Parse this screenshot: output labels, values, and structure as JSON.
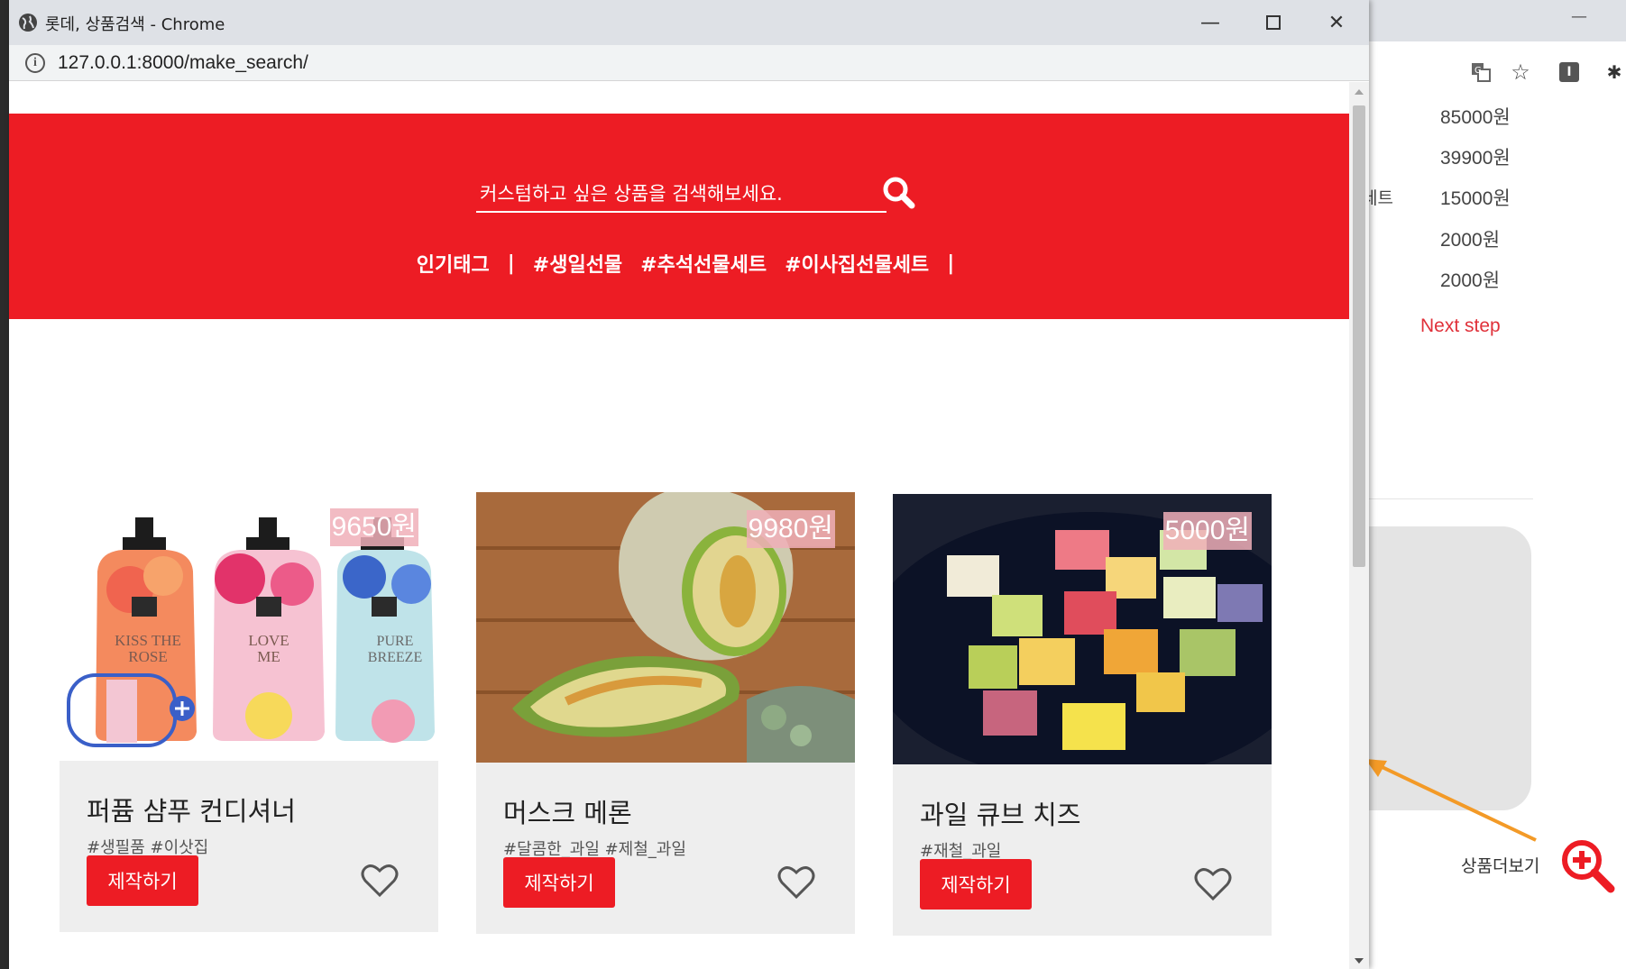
{
  "popup": {
    "window_title": "롯데, 상품검색 - Chrome",
    "url": "127.0.0.1:8000/make_search/",
    "search": {
      "placeholder": "커스텀하고 싶은 상품을 검색해보세요."
    },
    "tags_label": "인기태그",
    "separator": "|",
    "tags": [
      "#생일선물",
      "#추석선물세트",
      "#이사집선물세트"
    ],
    "products": [
      {
        "name": "퍼퓸 샴푸 컨디셔너",
        "tags": "#생필품 #이삿집",
        "price": "9650원",
        "button": "제작하기",
        "image": "shampoo-bottles-image"
      },
      {
        "name": "머스크 메론",
        "tags": "#달콤한_과일 #제철_과일",
        "price": "9980원",
        "button": "제작하기",
        "image": "melon-image"
      },
      {
        "name": "과일 큐브 치즈",
        "tags": "#재철_과일",
        "price": "5000원",
        "button": "제작하기",
        "image": "cheese-cubes-image"
      }
    ],
    "bottle_labels": [
      "KISS THE ROSE",
      "LOVE ME",
      "PURE BREEZE"
    ]
  },
  "background_window": {
    "prices": [
      "85000원",
      "39900원",
      "15000원",
      "2000원",
      "2000원"
    ],
    "partial_label": "세트",
    "next_step": "Next step",
    "more_products": "상품더보기"
  },
  "colors": {
    "brand_red": "#ed1c24",
    "price_badge": "#f0afb9",
    "annotation_arrow": "#f39a27"
  }
}
